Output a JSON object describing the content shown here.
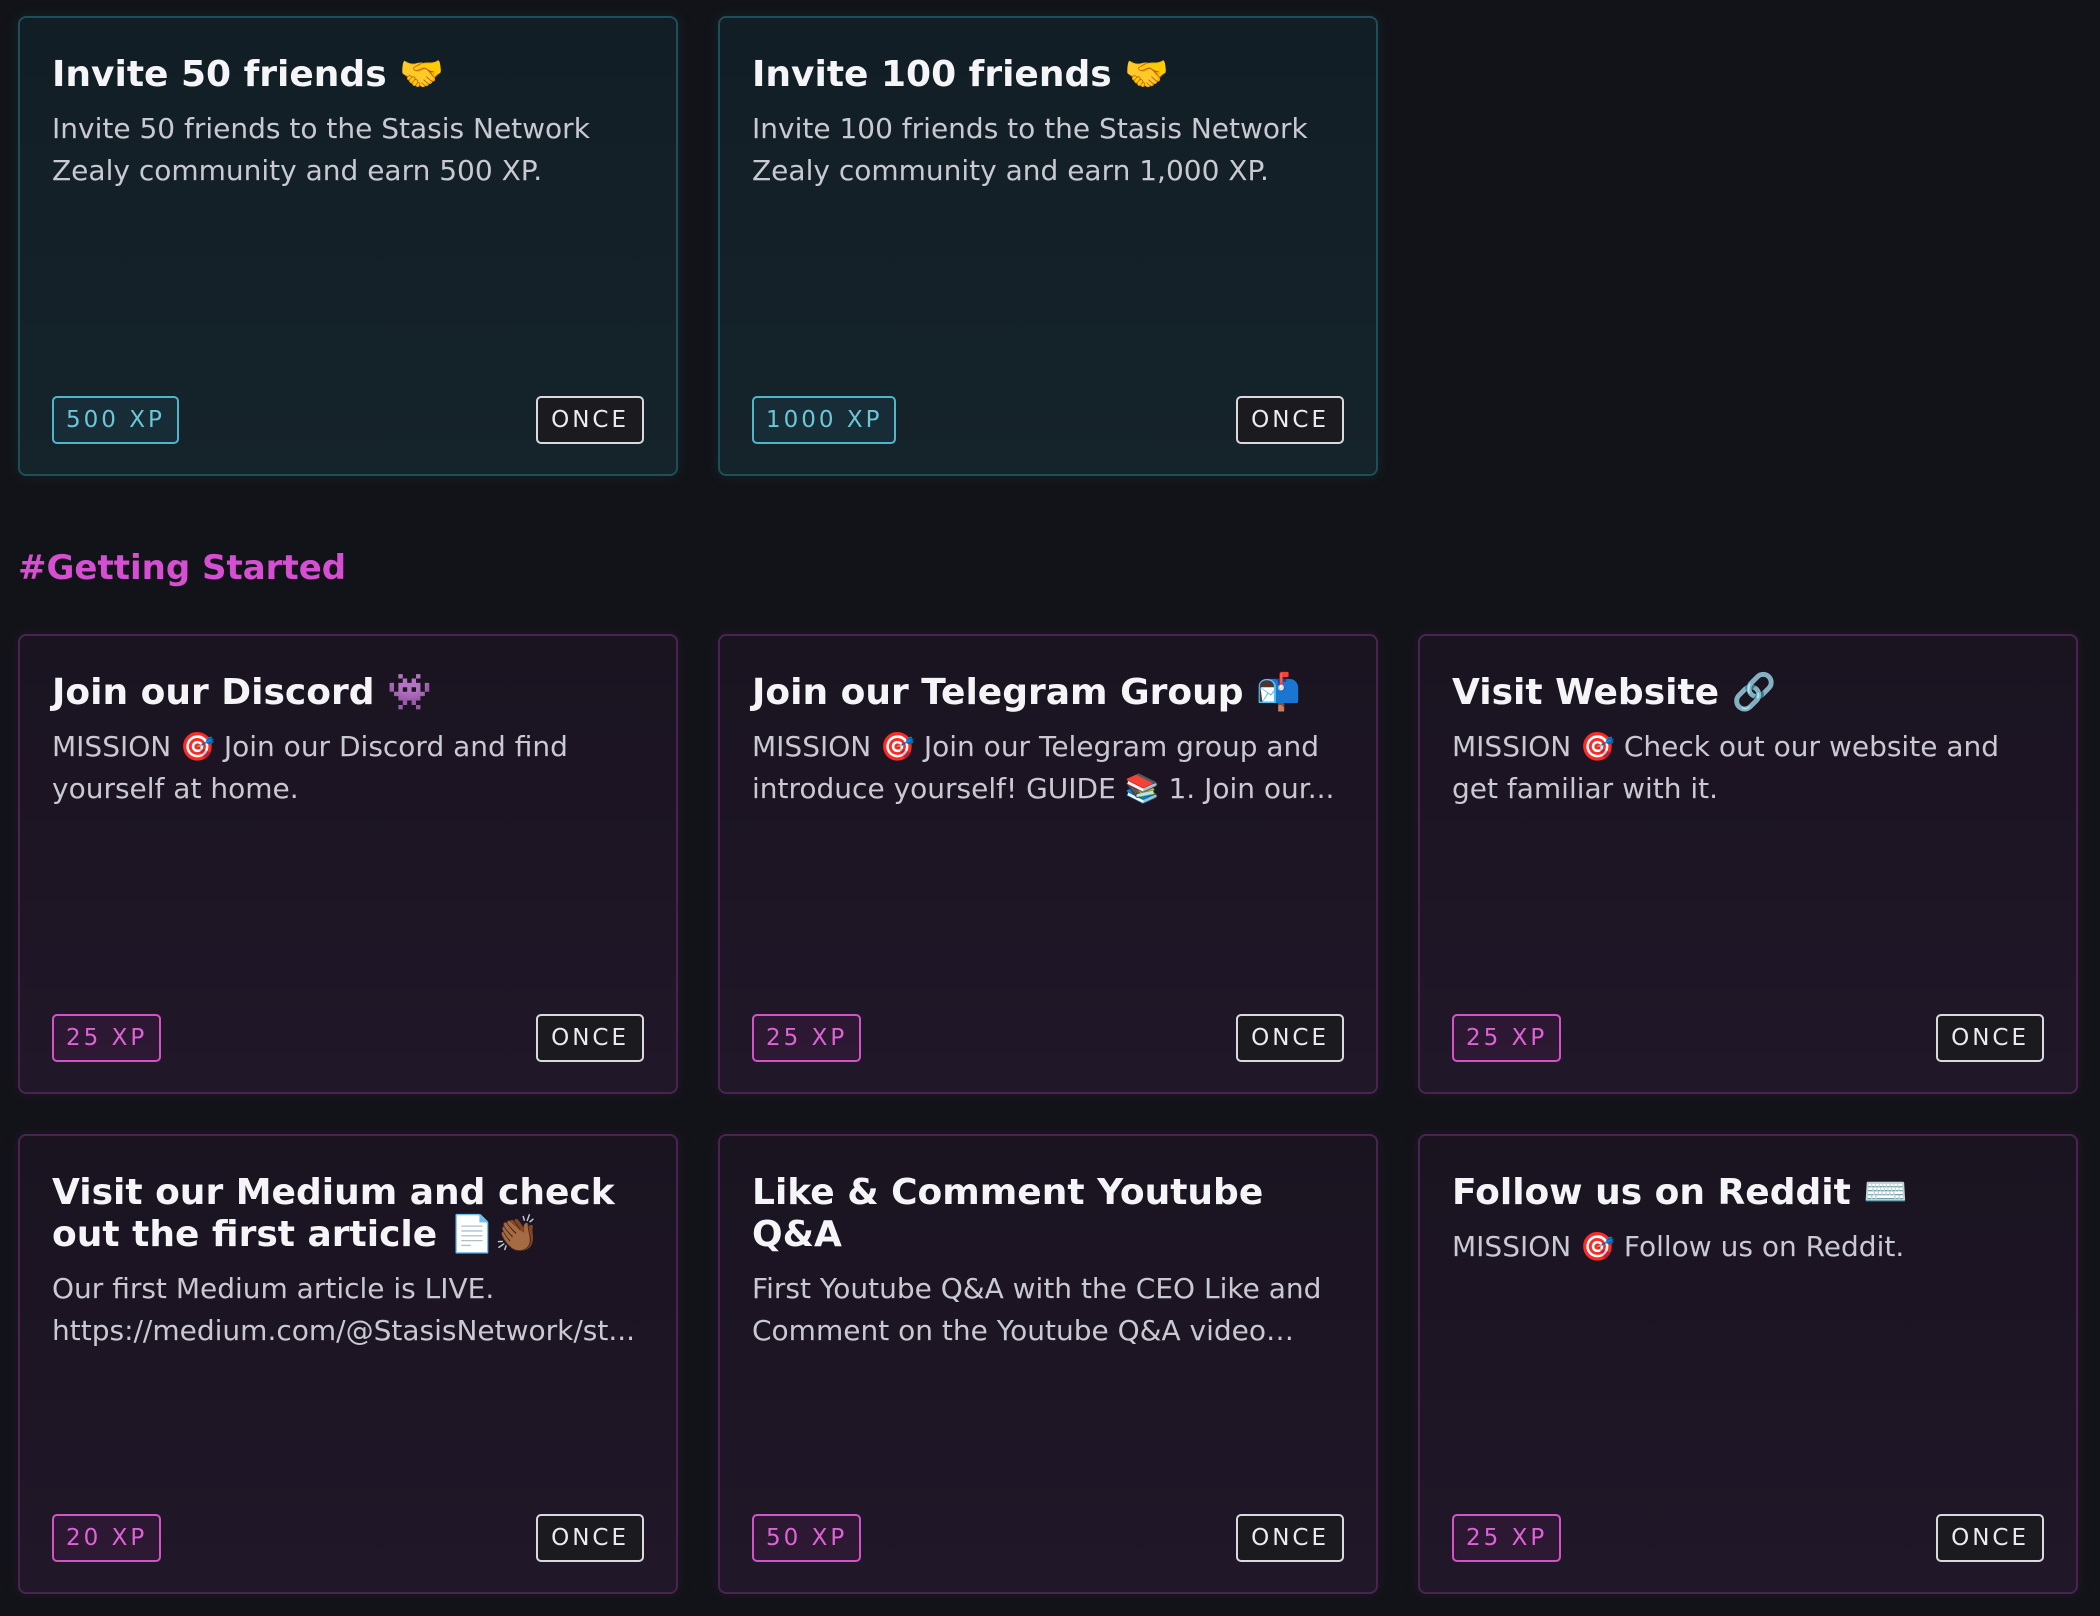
{
  "section_heading": "#Getting Started",
  "teal_cards": [
    {
      "title": "Invite 50 friends",
      "emoji": "🤝",
      "description": "Invite 50 friends to the Stasis Network Zealy community and earn 500 XP.",
      "xp": "500 XP",
      "recurrence": "ONCE"
    },
    {
      "title": "Invite 100 friends",
      "emoji": "🤝",
      "description": "Invite 100 friends to the Stasis Network Zealy community and earn 1,000 XP.",
      "xp": "1000 XP",
      "recurrence": "ONCE"
    }
  ],
  "quest_cards": [
    {
      "title": "Join our Discord",
      "emoji": "👾",
      "description": "MISSION 🎯 Join our Discord and find yourself at home.",
      "xp": "25 XP",
      "recurrence": "ONCE"
    },
    {
      "title": "Join our Telegram Group",
      "emoji": "📬",
      "description": "MISSION 🎯 Join our Telegram group and introduce yourself! GUIDE 📚 1. Join our...",
      "xp": "25 XP",
      "recurrence": "ONCE"
    },
    {
      "title": "Visit Website",
      "emoji": "🔗",
      "description": "MISSION 🎯 Check out our website and get familiar with it.",
      "xp": "25 XP",
      "recurrence": "ONCE"
    },
    {
      "title": "Visit our Medium and check out the first article",
      "emoji": "📄👏🏾",
      "description": "Our first Medium article is LIVE. https://medium.com/@StasisNetwork/st...",
      "xp": "20 XP",
      "recurrence": "ONCE"
    },
    {
      "title": "Like & Comment Youtube Q&A",
      "emoji": "",
      "description": "First Youtube Q&A with the CEO Like and Comment on the Youtube Q&A video and...",
      "xp": "50 XP",
      "recurrence": "ONCE"
    },
    {
      "title": "Follow us on Reddit",
      "emoji": "⌨️",
      "description": "MISSION 🎯 Follow us on Reddit.",
      "xp": "25 XP",
      "recurrence": "ONCE"
    }
  ],
  "colors": {
    "background": "#121318",
    "teal_accent": "#4fb5c8",
    "pink_accent": "#d353c9",
    "heading": "#d64fd2"
  }
}
